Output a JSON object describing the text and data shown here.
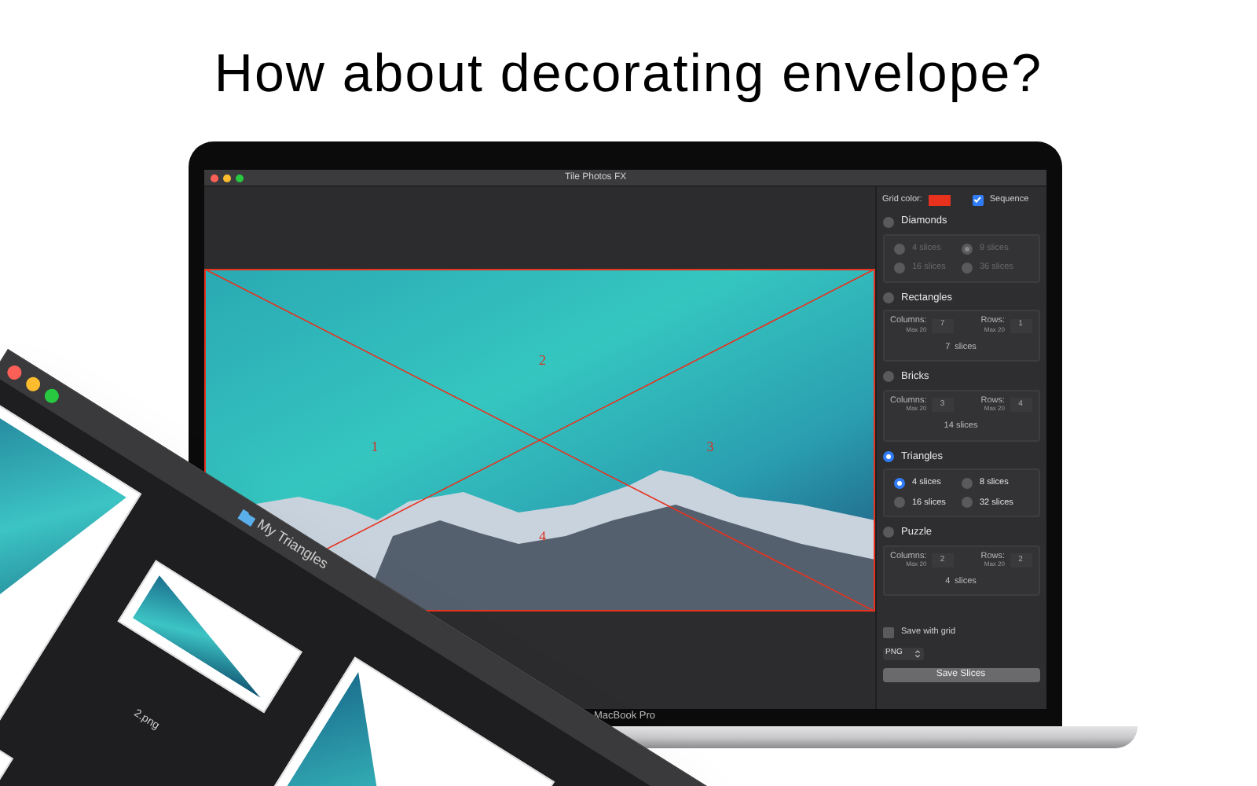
{
  "headline": "How about decorating envelope?",
  "window": {
    "title": "Tile Photos FX"
  },
  "canvas": {
    "region_labels": [
      "1",
      "2",
      "3",
      "4"
    ]
  },
  "sidebar": {
    "grid_color": {
      "label": "Grid color:",
      "color": "#e8321e"
    },
    "sequence": {
      "label": "Sequence",
      "checked": true
    },
    "modes": [
      {
        "kind": "options",
        "title": "Diamonds",
        "selected": false,
        "options": [
          {
            "label": "4 slices",
            "selected": false
          },
          {
            "label": "9 slices",
            "selected": true
          },
          {
            "label": "16 slices",
            "selected": false
          },
          {
            "label": "36 slices",
            "selected": false
          }
        ]
      },
      {
        "kind": "grid",
        "title": "Rectangles",
        "selected": false,
        "columns": {
          "label": "Columns:",
          "max": "Max 20",
          "value": "7"
        },
        "rows": {
          "label": "Rows:",
          "max": "Max 20",
          "value": "1"
        },
        "total": "7  slices"
      },
      {
        "kind": "grid",
        "title": "Bricks",
        "selected": false,
        "columns": {
          "label": "Columns:",
          "max": "Max 20",
          "value": "3"
        },
        "rows": {
          "label": "Rows:",
          "max": "Max 20",
          "value": "4"
        },
        "total": "14 slices"
      },
      {
        "kind": "options",
        "title": "Triangles",
        "selected": true,
        "options": [
          {
            "label": "4 slices",
            "selected": true
          },
          {
            "label": "8 slices",
            "selected": false
          },
          {
            "label": "16 slices",
            "selected": false
          },
          {
            "label": "32 slices",
            "selected": false
          }
        ]
      },
      {
        "kind": "grid",
        "title": "Puzzle",
        "selected": false,
        "columns": {
          "label": "Columns:",
          "max": "Max 20",
          "value": "2"
        },
        "rows": {
          "label": "Rows:",
          "max": "Max 20",
          "value": "2"
        },
        "total": "4  slices"
      }
    ],
    "save_with_grid": {
      "label": "Save with grid",
      "checked": false
    },
    "format": {
      "value": "PNG"
    },
    "save_button": "Save Slices"
  },
  "laptop": {
    "label": "MacBook Pro"
  },
  "finder_window": {
    "title": "My Triangles",
    "file_label": "2.png"
  }
}
